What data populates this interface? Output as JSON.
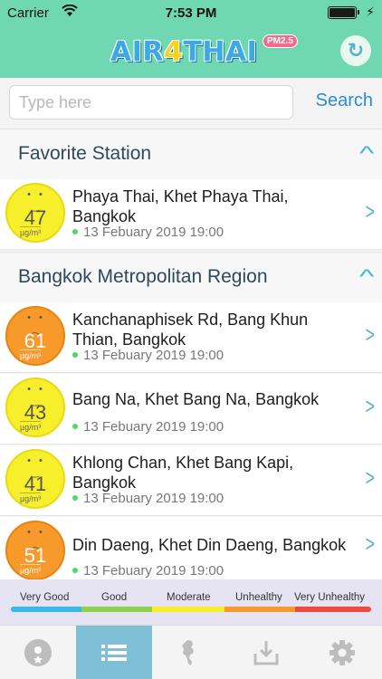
{
  "status_bar": {
    "carrier": "Carrier",
    "time": "7:53 PM"
  },
  "header": {
    "logo_text": "AIR4THAI",
    "logo_badge": "PM2.5",
    "refresh_icon": "refresh-icon"
  },
  "search": {
    "placeholder": "Type here",
    "button_label": "Search"
  },
  "sections": [
    {
      "title": "Favorite Station"
    },
    {
      "title": "Bangkok Metropolitan Region"
    }
  ],
  "unit_label": "µg/m³",
  "stations": [
    {
      "name": "Phaya Thai, Khet Phaya Thai, Bangkok",
      "value": "47",
      "level": "good",
      "date": "13 Febuary 2019 19:00"
    },
    {
      "name": "Kanchanaphisek Rd, Bang Khun Thian, Bangkok",
      "value": "61",
      "level": "unhealthy",
      "date": "13 Febuary 2019 19:00"
    },
    {
      "name": "Bang Na, Khet Bang Na, Bangkok",
      "value": "43",
      "level": "good",
      "date": "13 Febuary 2019 19:00"
    },
    {
      "name": "Khlong Chan, Khet Bang Kapi, Bangkok",
      "value": "41",
      "level": "good",
      "date": "13 Febuary 2019 19:00"
    },
    {
      "name": "Din Daeng, Khet Din Daeng, Bangkok",
      "value": "51",
      "level": "unhealthy",
      "date": "13 Febuary 2019 19:00"
    }
  ],
  "legend": {
    "labels": [
      "Very Good",
      "Good",
      "Moderate",
      "Unhealthy",
      "Very Unhealthy"
    ],
    "colors": [
      "#3bb8e8",
      "#8fd14f",
      "#f7ef2b",
      "#f79a2b",
      "#ef4a3c"
    ]
  },
  "tabs": [
    {
      "icon": "favorite-icon",
      "active": false
    },
    {
      "icon": "list-icon",
      "active": true
    },
    {
      "icon": "map-icon",
      "active": false
    },
    {
      "icon": "download-icon",
      "active": false
    },
    {
      "icon": "settings-icon",
      "active": false
    }
  ]
}
